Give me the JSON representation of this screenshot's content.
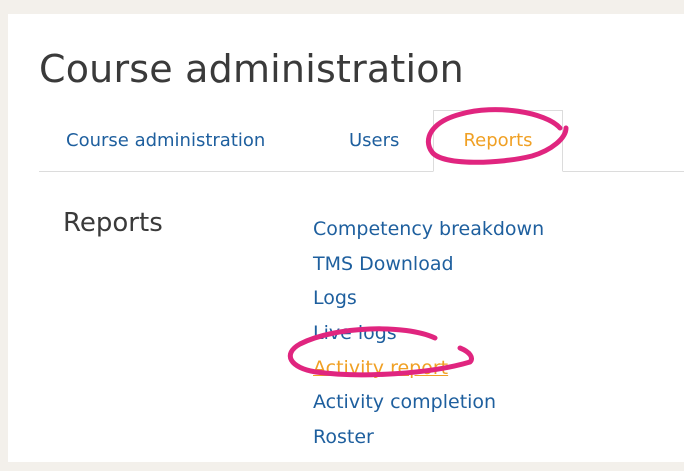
{
  "page": {
    "title": "Course administration"
  },
  "tabs": [
    {
      "label": "Course administration",
      "active": false
    },
    {
      "label": "Users",
      "active": false
    },
    {
      "label": "Reports",
      "active": true
    }
  ],
  "section": {
    "heading": "Reports"
  },
  "reports": [
    {
      "label": "Competency breakdown",
      "active": false
    },
    {
      "label": "TMS Download",
      "active": false
    },
    {
      "label": "Logs",
      "active": false
    },
    {
      "label": "Live logs",
      "active": false
    },
    {
      "label": "Activity report",
      "active": true
    },
    {
      "label": "Activity completion",
      "active": false
    },
    {
      "label": "Roster",
      "active": false
    }
  ],
  "colors": {
    "background": "#f3f0eb",
    "panel": "#ffffff",
    "link": "#1e5f9e",
    "active": "#f0a024",
    "text": "#3a3a3a",
    "annotation": "#e0257f"
  }
}
